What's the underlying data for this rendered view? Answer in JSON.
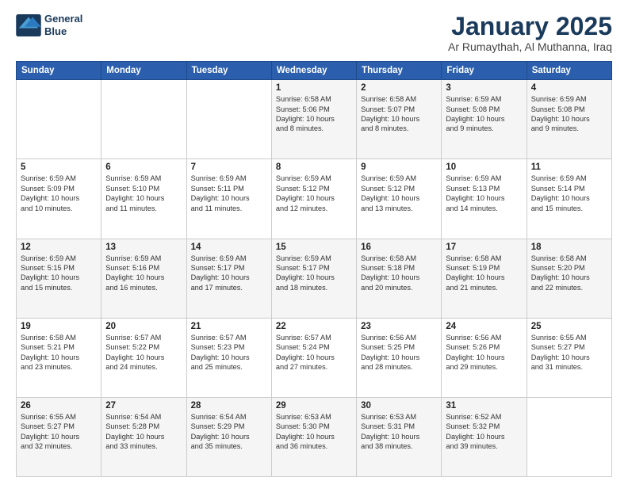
{
  "logo": {
    "line1": "General",
    "line2": "Blue"
  },
  "title": "January 2025",
  "subtitle": "Ar Rumaythah, Al Muthanna, Iraq",
  "weekdays": [
    "Sunday",
    "Monday",
    "Tuesday",
    "Wednesday",
    "Thursday",
    "Friday",
    "Saturday"
  ],
  "weeks": [
    [
      {
        "day": "",
        "info": ""
      },
      {
        "day": "",
        "info": ""
      },
      {
        "day": "",
        "info": ""
      },
      {
        "day": "1",
        "info": "Sunrise: 6:58 AM\nSunset: 5:06 PM\nDaylight: 10 hours\nand 8 minutes."
      },
      {
        "day": "2",
        "info": "Sunrise: 6:58 AM\nSunset: 5:07 PM\nDaylight: 10 hours\nand 8 minutes."
      },
      {
        "day": "3",
        "info": "Sunrise: 6:59 AM\nSunset: 5:08 PM\nDaylight: 10 hours\nand 9 minutes."
      },
      {
        "day": "4",
        "info": "Sunrise: 6:59 AM\nSunset: 5:08 PM\nDaylight: 10 hours\nand 9 minutes."
      }
    ],
    [
      {
        "day": "5",
        "info": "Sunrise: 6:59 AM\nSunset: 5:09 PM\nDaylight: 10 hours\nand 10 minutes."
      },
      {
        "day": "6",
        "info": "Sunrise: 6:59 AM\nSunset: 5:10 PM\nDaylight: 10 hours\nand 11 minutes."
      },
      {
        "day": "7",
        "info": "Sunrise: 6:59 AM\nSunset: 5:11 PM\nDaylight: 10 hours\nand 11 minutes."
      },
      {
        "day": "8",
        "info": "Sunrise: 6:59 AM\nSunset: 5:12 PM\nDaylight: 10 hours\nand 12 minutes."
      },
      {
        "day": "9",
        "info": "Sunrise: 6:59 AM\nSunset: 5:12 PM\nDaylight: 10 hours\nand 13 minutes."
      },
      {
        "day": "10",
        "info": "Sunrise: 6:59 AM\nSunset: 5:13 PM\nDaylight: 10 hours\nand 14 minutes."
      },
      {
        "day": "11",
        "info": "Sunrise: 6:59 AM\nSunset: 5:14 PM\nDaylight: 10 hours\nand 15 minutes."
      }
    ],
    [
      {
        "day": "12",
        "info": "Sunrise: 6:59 AM\nSunset: 5:15 PM\nDaylight: 10 hours\nand 15 minutes."
      },
      {
        "day": "13",
        "info": "Sunrise: 6:59 AM\nSunset: 5:16 PM\nDaylight: 10 hours\nand 16 minutes."
      },
      {
        "day": "14",
        "info": "Sunrise: 6:59 AM\nSunset: 5:17 PM\nDaylight: 10 hours\nand 17 minutes."
      },
      {
        "day": "15",
        "info": "Sunrise: 6:59 AM\nSunset: 5:17 PM\nDaylight: 10 hours\nand 18 minutes."
      },
      {
        "day": "16",
        "info": "Sunrise: 6:58 AM\nSunset: 5:18 PM\nDaylight: 10 hours\nand 20 minutes."
      },
      {
        "day": "17",
        "info": "Sunrise: 6:58 AM\nSunset: 5:19 PM\nDaylight: 10 hours\nand 21 minutes."
      },
      {
        "day": "18",
        "info": "Sunrise: 6:58 AM\nSunset: 5:20 PM\nDaylight: 10 hours\nand 22 minutes."
      }
    ],
    [
      {
        "day": "19",
        "info": "Sunrise: 6:58 AM\nSunset: 5:21 PM\nDaylight: 10 hours\nand 23 minutes."
      },
      {
        "day": "20",
        "info": "Sunrise: 6:57 AM\nSunset: 5:22 PM\nDaylight: 10 hours\nand 24 minutes."
      },
      {
        "day": "21",
        "info": "Sunrise: 6:57 AM\nSunset: 5:23 PM\nDaylight: 10 hours\nand 25 minutes."
      },
      {
        "day": "22",
        "info": "Sunrise: 6:57 AM\nSunset: 5:24 PM\nDaylight: 10 hours\nand 27 minutes."
      },
      {
        "day": "23",
        "info": "Sunrise: 6:56 AM\nSunset: 5:25 PM\nDaylight: 10 hours\nand 28 minutes."
      },
      {
        "day": "24",
        "info": "Sunrise: 6:56 AM\nSunset: 5:26 PM\nDaylight: 10 hours\nand 29 minutes."
      },
      {
        "day": "25",
        "info": "Sunrise: 6:55 AM\nSunset: 5:27 PM\nDaylight: 10 hours\nand 31 minutes."
      }
    ],
    [
      {
        "day": "26",
        "info": "Sunrise: 6:55 AM\nSunset: 5:27 PM\nDaylight: 10 hours\nand 32 minutes."
      },
      {
        "day": "27",
        "info": "Sunrise: 6:54 AM\nSunset: 5:28 PM\nDaylight: 10 hours\nand 33 minutes."
      },
      {
        "day": "28",
        "info": "Sunrise: 6:54 AM\nSunset: 5:29 PM\nDaylight: 10 hours\nand 35 minutes."
      },
      {
        "day": "29",
        "info": "Sunrise: 6:53 AM\nSunset: 5:30 PM\nDaylight: 10 hours\nand 36 minutes."
      },
      {
        "day": "30",
        "info": "Sunrise: 6:53 AM\nSunset: 5:31 PM\nDaylight: 10 hours\nand 38 minutes."
      },
      {
        "day": "31",
        "info": "Sunrise: 6:52 AM\nSunset: 5:32 PM\nDaylight: 10 hours\nand 39 minutes."
      },
      {
        "day": "",
        "info": ""
      }
    ]
  ]
}
